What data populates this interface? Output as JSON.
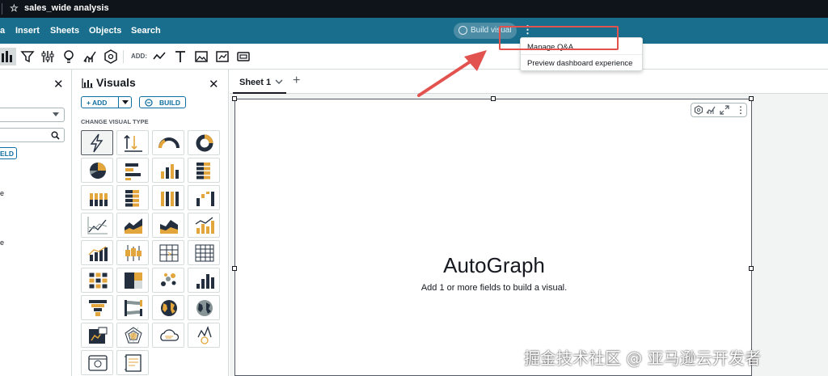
{
  "window": {
    "title": "sales_wide analysis"
  },
  "menu": {
    "items": [
      "a",
      "Insert",
      "Sheets",
      "Objects",
      "Search"
    ],
    "build_visual": "Build visual"
  },
  "toolbar": {
    "add_label": "ADD:"
  },
  "dropdown": {
    "items": [
      "Manage Q&A",
      "Preview dashboard experience"
    ]
  },
  "visuals_panel": {
    "title": "Visuals",
    "add_label": "+ ADD",
    "build_label": "BUILD",
    "change_type_label": "CHANGE VISUAL TYPE"
  },
  "left_panel": {
    "field_button": "ELD",
    "partial_chars": [
      "e",
      "e"
    ]
  },
  "sheet": {
    "tab_label": "Sheet 1",
    "add_icon": "+"
  },
  "visual": {
    "title": "AutoGraph",
    "subtitle": "Add 1 or more fields to build a visual."
  },
  "watermark": "掘金技术社区 @ 亚马逊云开发者",
  "colors": {
    "menu_bar": "#186e8c",
    "title_bar": "#0f141a",
    "highlight": "#e2534f",
    "accent": "#0f6fa3",
    "icon_orange": "#e3a63c",
    "icon_navy": "#232f3e"
  },
  "visual_types": [
    "autograph",
    "kpi",
    "gauge",
    "donut",
    "pie",
    "horizontal-bar",
    "vertical-bar",
    "horizontal-stacked-bar",
    "vertical-stacked-bar",
    "horizontal-100-bar",
    "vertical-100-bar",
    "waterfall",
    "line",
    "area",
    "stacked-area",
    "combo",
    "bar-line-combo",
    "box-plot",
    "table",
    "pivot-table",
    "heat-map",
    "tree-map",
    "scatter",
    "histogram",
    "funnel",
    "sankey",
    "filled-map",
    "point-map",
    "insight",
    "radar",
    "word-cloud",
    "custom-visual",
    "text-box",
    "insight-narrative"
  ]
}
